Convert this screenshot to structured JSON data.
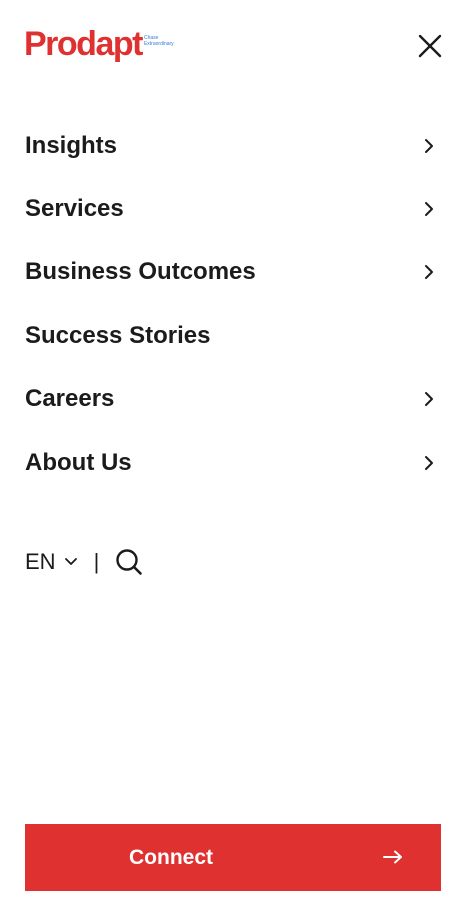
{
  "header": {
    "logo": {
      "text": "Prodapt",
      "tagline": [
        "Chase",
        "Extraordinary"
      ],
      "color": "#e03131",
      "tagline_color": "#3a7bd5"
    },
    "close_icon": "close-icon"
  },
  "nav": {
    "items": [
      {
        "label": "Insights",
        "has_submenu": true
      },
      {
        "label": "Services",
        "has_submenu": true
      },
      {
        "label": "Business Outcomes",
        "has_submenu": true
      },
      {
        "label": "Success Stories",
        "has_submenu": false
      },
      {
        "label": "Careers",
        "has_submenu": true
      },
      {
        "label": "About Us",
        "has_submenu": true
      }
    ]
  },
  "tools": {
    "language": "EN",
    "separator": "|",
    "search_icon": "search-icon"
  },
  "cta": {
    "label": "Connect",
    "icon": "arrow-right-icon",
    "background": "#e03131"
  }
}
